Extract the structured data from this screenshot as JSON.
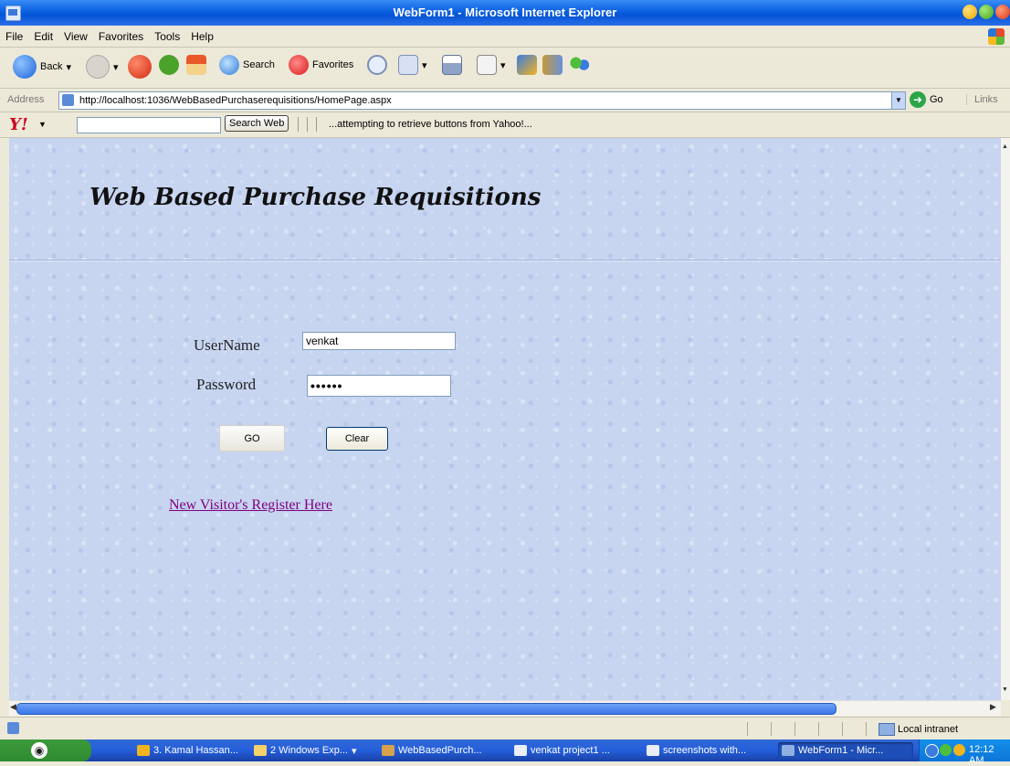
{
  "window": {
    "title": "WebForm1 - Microsoft Internet Explorer"
  },
  "menu": [
    "File",
    "Edit",
    "View",
    "Favorites",
    "Tools",
    "Help"
  ],
  "toolbar": {
    "back": "Back",
    "search": "Search",
    "favorites": "Favorites"
  },
  "address": {
    "label": "Address",
    "url": "http://localhost:1036/WebBasedPurchaserequisitions/HomePage.aspx",
    "go": "Go",
    "links": "Links"
  },
  "yahoo": {
    "search_button": "Search Web",
    "status": "...attempting to retrieve buttons from Yahoo!..."
  },
  "page": {
    "title": "Web Based Purchase Requisitions",
    "username_label": "UserName",
    "username_value": "venkat",
    "password_label": "Password",
    "password_value": "••••••",
    "go_button": "GO",
    "clear_button": "Clear",
    "register_link": "New Visitor's Register Here"
  },
  "status": {
    "zone": "Local intranet"
  },
  "taskbar": {
    "items": [
      "3. Kamal Hassan...",
      "2 Windows Exp...",
      "WebBasedPurch...",
      "venkat project1 ...",
      "screenshots with...",
      "WebForm1 - Micr..."
    ],
    "time": "12:12 AM"
  }
}
